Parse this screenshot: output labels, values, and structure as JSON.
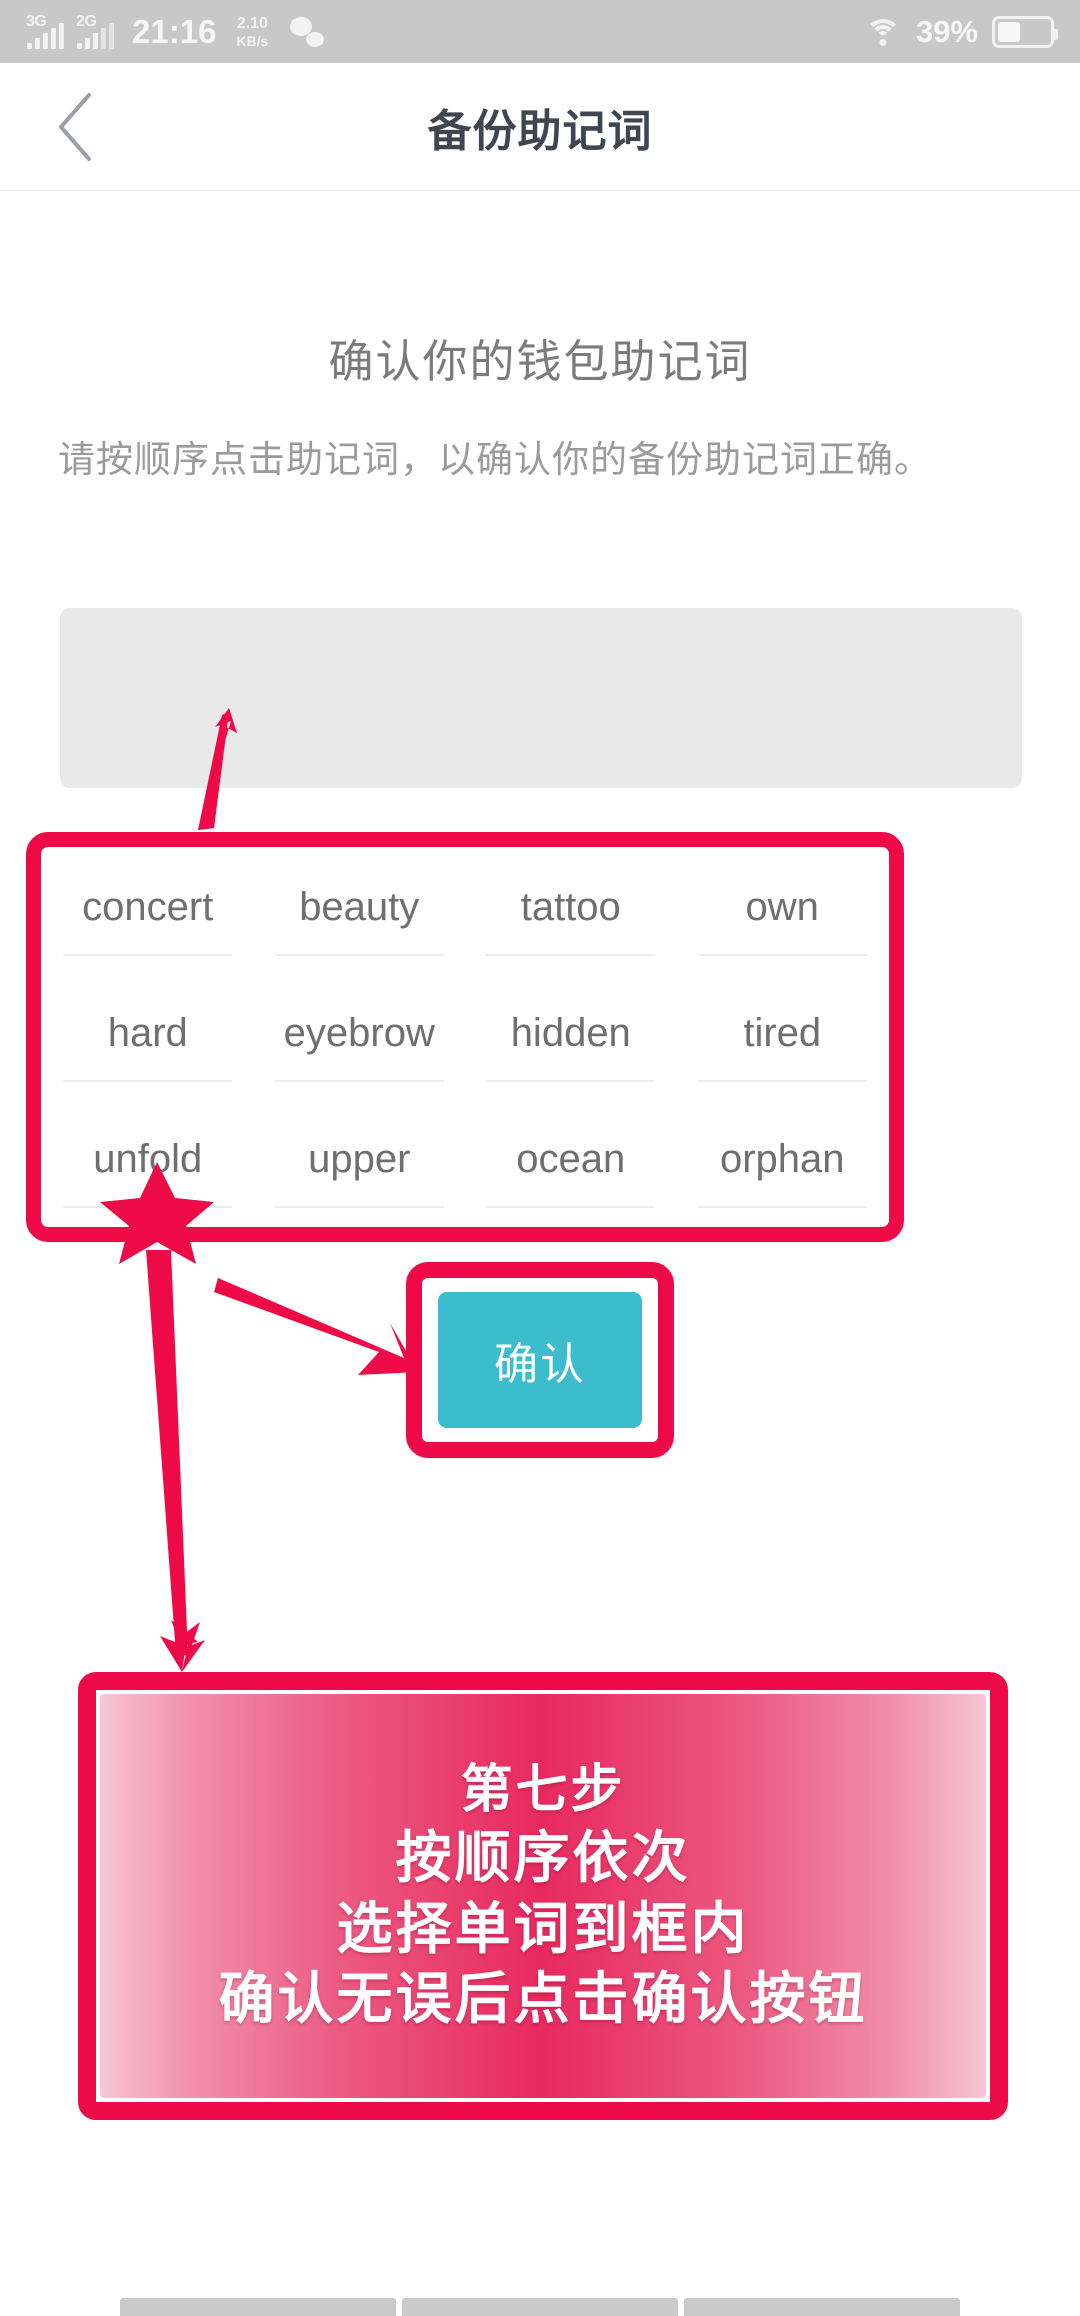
{
  "status_bar": {
    "network_primary": "3G",
    "network_secondary": "2G",
    "time": "21:16",
    "net_speed_value": "2.10",
    "net_speed_unit": "KB/s",
    "wechat_icon": "wechat-icon",
    "wifi_icon": "wifi-icon",
    "battery_percent": "39%",
    "battery_icon": "battery-icon"
  },
  "nav": {
    "back_icon": "back-chevron-icon",
    "title": "备份助记词"
  },
  "content": {
    "heading": "确认你的钱包助记词",
    "description": "请按顺序点击助记词，以确认你的备份助记词正确。",
    "answer_box_value": "",
    "answer_box_placeholder": ""
  },
  "word_grid": {
    "words": [
      "concert",
      "beauty",
      "tattoo",
      "own",
      "hard",
      "eyebrow",
      "hidden",
      "tired",
      "unfold",
      "upper",
      "ocean",
      "orphan"
    ]
  },
  "confirm_button": {
    "label": "确认"
  },
  "instruction_banner": {
    "line1": "第七步",
    "line2": "按顺序依次",
    "line3": "选择单词到框内",
    "line4": "确认无误后点击确认按钮"
  },
  "colors": {
    "annotation_red": "#ee0a46",
    "confirm_teal": "#3bbdce",
    "banner_pink_edge": "#f7c6d5",
    "banner_pink_center": "#e8295f",
    "status_bar_gray": "#c8c8c8",
    "title_gray": "#3f4650",
    "body_gray": "#9b9b9b",
    "answer_box_gray": "#e9e9e9"
  },
  "annotations": {
    "arrow_to_answer_box": "arrow-up-icon",
    "arrow_to_confirm_button": "arrow-right-icon",
    "arrow_grid_to_banner": "double-arrow-icon"
  }
}
